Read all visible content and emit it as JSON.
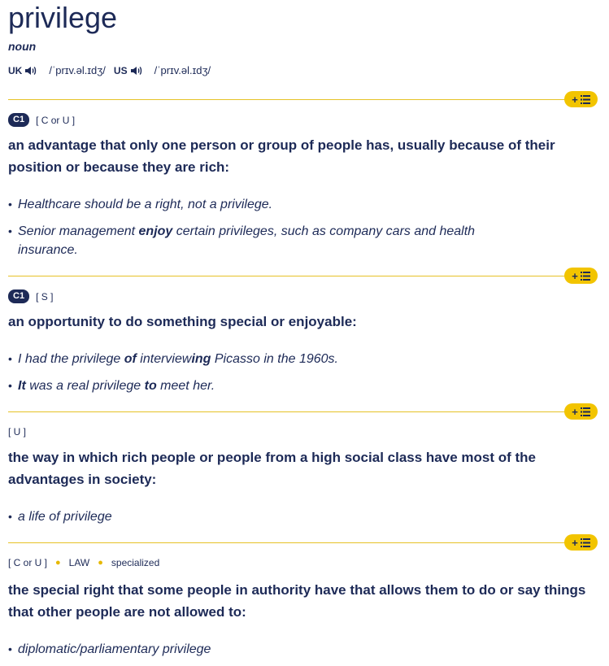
{
  "entry": {
    "headword": "privilege",
    "part_of_speech": "noun",
    "pronunciations": [
      {
        "region": "UK",
        "ipa": "/ˈprɪv.əl.ɪdʒ/"
      },
      {
        "region": "US",
        "ipa": "/ˈprɪv.əl.ɪdʒ/"
      }
    ]
  },
  "senses": [
    {
      "level": "C1",
      "grammar": "[ C or U ]",
      "definition": "an advantage that only one person or group of people has, usually because of their position or because they are rich:",
      "examples": [
        [
          {
            "t": "Healthcare should be a right, not a privilege.",
            "b": false
          }
        ],
        [
          {
            "t": "Senior management ",
            "b": false
          },
          {
            "t": "enjoy",
            "b": true
          },
          {
            "t": " certain privileges, such as company cars and health insurance.",
            "b": false
          }
        ]
      ]
    },
    {
      "level": "C1",
      "grammar": "[ S ]",
      "definition": "an opportunity to do something special or enjoyable:",
      "examples": [
        [
          {
            "t": "I had the privilege ",
            "b": false
          },
          {
            "t": "of",
            "b": true
          },
          {
            "t": " interview",
            "b": false
          },
          {
            "t": "ing",
            "b": true
          },
          {
            "t": " Picasso in the 1960s.",
            "b": false
          }
        ],
        [
          {
            "t": "It",
            "b": true
          },
          {
            "t": " was a real privilege ",
            "b": false
          },
          {
            "t": "to",
            "b": true
          },
          {
            "t": " meet her.",
            "b": false
          }
        ]
      ]
    },
    {
      "level": "",
      "grammar": "[ U ]",
      "definition": "the way in which rich people or people from a high social class have most of the advantages in society:",
      "examples": [
        [
          {
            "t": "a life of privilege",
            "b": false
          }
        ]
      ]
    },
    {
      "level": "",
      "grammar": "[ C or U ]",
      "domain": "LAW",
      "register": "specialized",
      "definition": "the special right that some people in authority have that allows them to do or say things that other people are not allowed to:",
      "examples": [
        [
          {
            "t": "diplomatic/parliamentary privilege",
            "b": false
          }
        ]
      ]
    }
  ],
  "colors": {
    "navy": "#1d2a57",
    "accent_yellow": "#f2c400",
    "divider": "#e6c227"
  },
  "icons": {
    "speaker": "speaker-icon",
    "add": "plus-icon",
    "list": "list-icon"
  }
}
